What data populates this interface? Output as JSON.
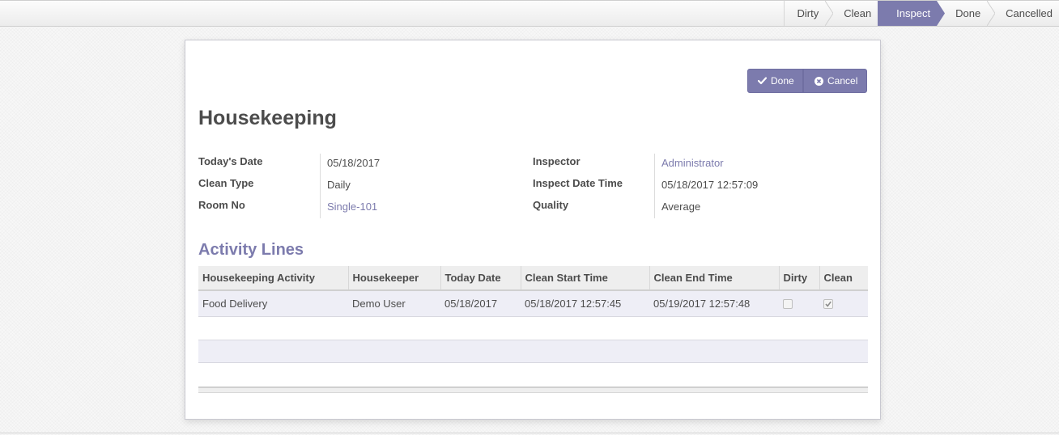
{
  "statusbar": {
    "stages": [
      {
        "label": "Dirty",
        "active": false
      },
      {
        "label": "Clean",
        "active": false
      },
      {
        "label": "Inspect",
        "active": true
      },
      {
        "label": "Done",
        "active": false
      },
      {
        "label": "Cancelled",
        "active": false
      }
    ]
  },
  "header_buttons": {
    "done": {
      "label": "Done",
      "icon": "check-icon"
    },
    "cancel": {
      "label": "Cancel",
      "icon": "times-circle-icon"
    }
  },
  "form": {
    "title": "Housekeeping",
    "left_fields": [
      {
        "label": "Today's Date",
        "value": "05/18/2017",
        "link": false
      },
      {
        "label": "Clean Type",
        "value": "Daily",
        "link": false
      },
      {
        "label": "Room No",
        "value": "Single-101",
        "link": true
      }
    ],
    "right_fields": [
      {
        "label": "Inspector",
        "value": "Administrator",
        "link": true
      },
      {
        "label": "Inspect Date Time",
        "value": "05/18/2017 12:57:09",
        "link": false
      },
      {
        "label": "Quality",
        "value": "Average",
        "link": false
      }
    ]
  },
  "activity_lines": {
    "title": "Activity Lines",
    "columns": [
      "Housekeeping Activity",
      "Housekeeper",
      "Today Date",
      "Clean Start Time",
      "Clean End Time",
      "Dirty",
      "Clean"
    ],
    "rows": [
      {
        "activity": "Food Delivery",
        "housekeeper": "Demo User",
        "today_date": "05/18/2017",
        "clean_start_time": "05/18/2017 12:57:45",
        "clean_end_time": "05/19/2017 12:57:48",
        "dirty": false,
        "clean": true
      }
    ]
  },
  "colors": {
    "accent": "#7c7bad",
    "row_bg": "#eeeef6",
    "header_bg": "#eeeeee"
  }
}
